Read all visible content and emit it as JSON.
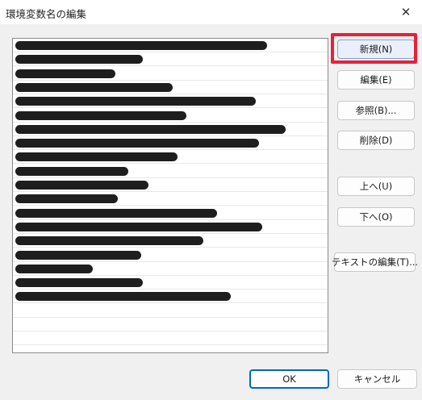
{
  "dialog": {
    "title": "環境変数名の編集",
    "close_glyph": "✕"
  },
  "list": {
    "row_count": 22
  },
  "buttons": {
    "new": "新規(N)",
    "edit": "編集(E)",
    "browse": "参照(B)...",
    "delete": "削除(D)",
    "move_up": "上へ(U)",
    "move_down": "下へ(O)",
    "edit_text": "テキストの編集(T)...",
    "ok": "OK",
    "cancel": "キャンセル"
  },
  "colors": {
    "highlight": "#e8203a",
    "accent": "#0067c0"
  }
}
